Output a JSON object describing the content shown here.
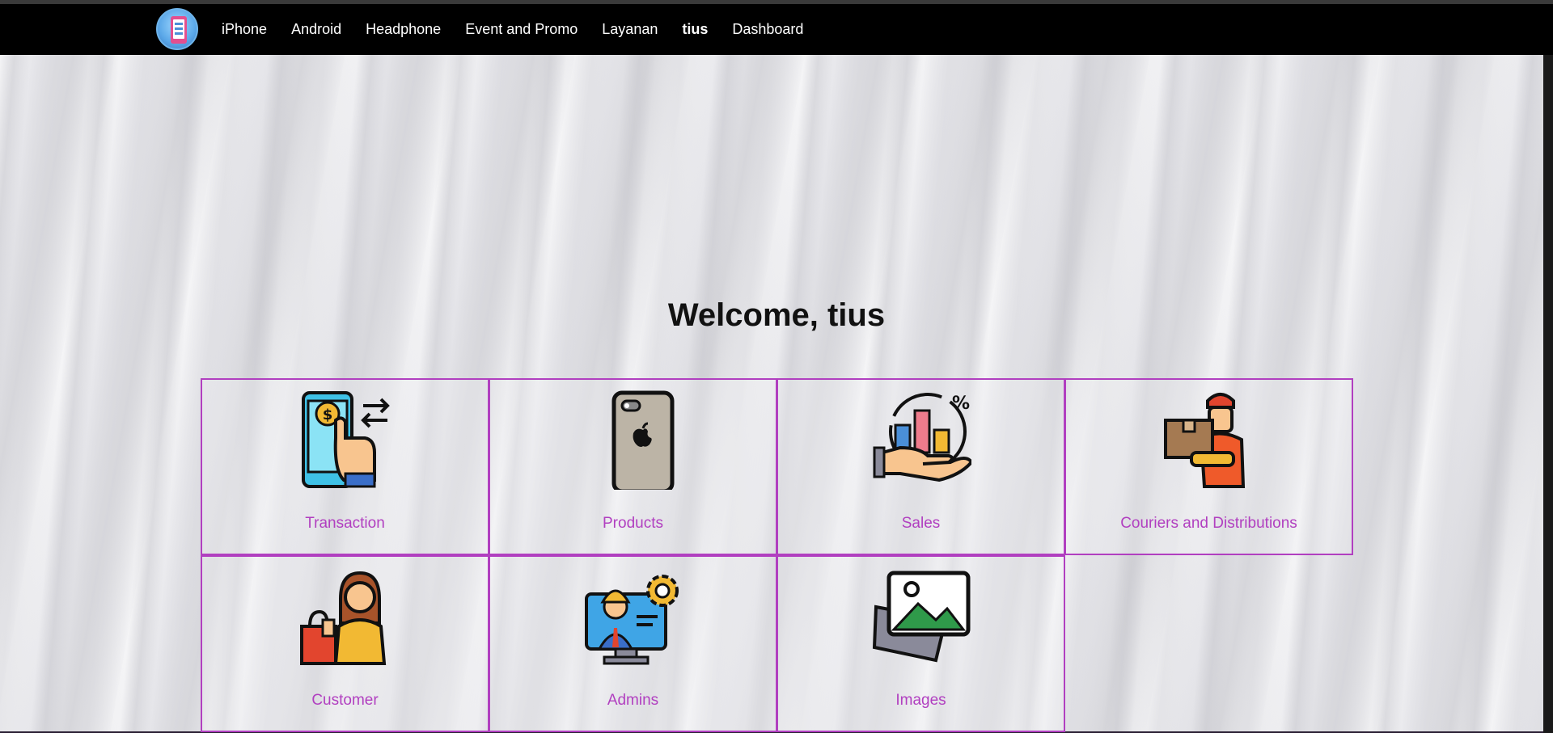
{
  "nav": {
    "logo_icon": "phone-store-logo-icon",
    "links": [
      "iPhone",
      "Android",
      "Headphone",
      "Event and Promo",
      "Layanan",
      "tius",
      "Dashboard"
    ]
  },
  "main": {
    "welcome": "Welcome, tius",
    "cards": [
      {
        "label": "Transaction",
        "icon": "mobile-payment-icon"
      },
      {
        "label": "Products",
        "icon": "iphone-icon"
      },
      {
        "label": "Sales",
        "icon": "sales-chart-icon"
      },
      {
        "label": "Couriers and Distributions",
        "icon": "courier-icon"
      },
      {
        "label": "Customer",
        "icon": "customer-shopping-icon"
      },
      {
        "label": "Admins",
        "icon": "admin-icon"
      },
      {
        "label": "Images",
        "icon": "images-icon"
      }
    ]
  },
  "colors": {
    "accent": "#b13fc0",
    "navbar": "#000000"
  }
}
